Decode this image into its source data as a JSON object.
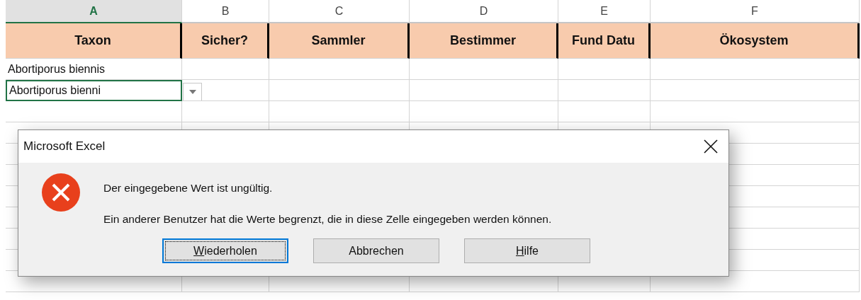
{
  "columns": [
    {
      "letter": "A",
      "selected": true
    },
    {
      "letter": "B",
      "selected": false
    },
    {
      "letter": "C",
      "selected": false
    },
    {
      "letter": "D",
      "selected": false
    },
    {
      "letter": "E",
      "selected": false
    },
    {
      "letter": "F",
      "selected": false
    }
  ],
  "header_row": [
    "Taxon",
    "Sicher?",
    "Sammler",
    "Bestimmer",
    "Fund Datu",
    "Ökosystem"
  ],
  "rows": [
    {
      "taxon": "Abortiporus biennis",
      "active": false,
      "dropdown": false
    },
    {
      "taxon": "Abortiporus bienni",
      "active": true,
      "dropdown": true
    }
  ],
  "dialog": {
    "title": "Microsoft Excel",
    "messages": [
      "Der eingegebene Wert ist ungültig.",
      "Ein anderer Benutzer hat die Werte begrenzt, die in diese Zelle eingegeben werden können."
    ],
    "buttons": [
      {
        "label": "Wiederholen",
        "underline_first": true,
        "default": true
      },
      {
        "label": "Abbrechen",
        "underline_first": false,
        "default": false
      },
      {
        "label": "Hilfe",
        "underline_first": true,
        "default": false
      }
    ]
  }
}
